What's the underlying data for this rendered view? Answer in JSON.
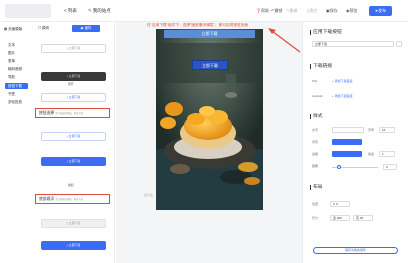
{
  "topbar": {
    "back_label": "< 列表",
    "page_name": "我的站点",
    "items": [
      {
        "label": "帮助",
        "disabled": false
      },
      {
        "label": "撤销",
        "disabled": false
      },
      {
        "label": "重做",
        "disabled": true
      },
      {
        "label": "清空",
        "disabled": true
      },
      {
        "label": "保存",
        "disabled": false
      },
      {
        "label": "预览",
        "disabled": false
      }
    ],
    "publish_label": "发布"
  },
  "leftnav": {
    "tab_label": "页面模版",
    "items": [
      "文本",
      "图片",
      "表单",
      "输码音频",
      "导航",
      "按钮下载",
      "书签",
      "多轮投放"
    ],
    "active_index": 5
  },
  "midpanel": {
    "tabs": [
      "模块",
      "诸件"
    ],
    "active_tab": 1,
    "components": [
      {
        "label": "立即下载",
        "style": "outline"
      },
      {
        "label": "立即下载",
        "style": "dark"
      },
      {
        "label": "立即下载",
        "style": "outline"
      },
      {
        "label": "立即下载",
        "style": "blue"
      },
      {
        "label": "立即下载",
        "style": "outline"
      },
      {
        "label": "立即下载",
        "style": "outline"
      },
      {
        "label": "立即下载",
        "style": "blue"
      }
    ],
    "sections": [
      {
        "title": "按钮选择",
        "hint": "需下载按钮地域，再选下载"
      },
      {
        "title": "底部悬浮",
        "hint": "需下载按钮地域，再选下载"
      }
    ],
    "section_labels": [
      "展开",
      "收起"
    ]
  },
  "canvas": {
    "annotation": "在\"应用下载\"组件下，选择\"固底悬浮弹层\"，即可实现常驻页面",
    "top_bar_label": "立即下载",
    "download_button_label": "立即下载",
    "footer": "最大宽"
  },
  "right": {
    "sections": [
      "应用下载按钮",
      "下载链接",
      "样式",
      "布局"
    ],
    "title_field": "立即下载",
    "ios_label": "iOS",
    "android_label": "Android",
    "add_link": "+ 添加下载链接",
    "style": {
      "font_label": "文字",
      "font_size": "字号",
      "font_size_value": "16",
      "bg_label": "背景",
      "border_label": "边框",
      "border_width": "线宽",
      "border_width_value": "1",
      "radius_label": "圆角",
      "radius_value": "0",
      "radius_level": 0.15,
      "accent": "#3b6cf6"
    },
    "layout": {
      "position_label": "位置",
      "x_label": "X",
      "x_value": "0",
      "y_label": "Y",
      "y_value": "0",
      "size_label": "尺寸",
      "w_label": "宽",
      "w_value": "300",
      "h_label": "高",
      "h_value": "45"
    },
    "save_label": "保存为我的组件"
  }
}
